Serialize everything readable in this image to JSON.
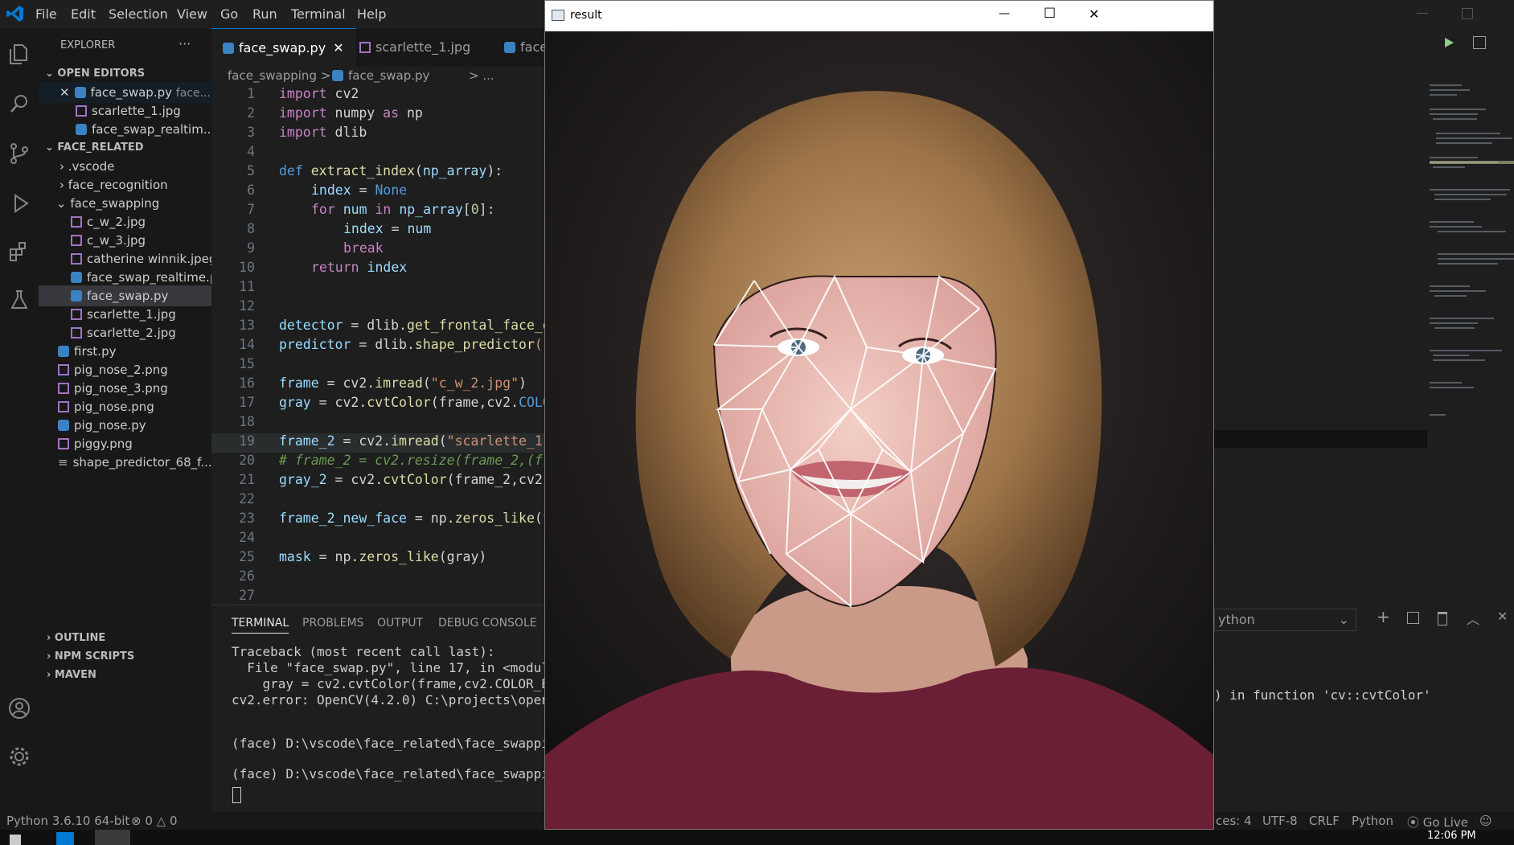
{
  "menu": [
    "File",
    "Edit",
    "Selection",
    "View",
    "Go",
    "Run",
    "Terminal",
    "Help"
  ],
  "explorer": {
    "title": "EXPLORER",
    "more": "···",
    "open_editors_label": "OPEN EDITORS",
    "open_editors": [
      "face_swap.py",
      "scarlette_1.jpg",
      "face_swap_realtim..."
    ],
    "open_editor_hint": "face...",
    "folder_label": "FACE_RELATED",
    "folders": [
      ".vscode",
      "face_recognition",
      "face_swapping"
    ],
    "face_swapping_files": [
      "c_w_2.jpg",
      "c_w_3.jpg",
      "catherine winnik.jpeg",
      "face_swap_realtime.py",
      "face_swap.py",
      "scarlette_1.jpg",
      "scarlette_2.jpg"
    ],
    "root_files": [
      "first.py",
      "pig_nose_2.png",
      "pig_nose_3.png",
      "pig_nose.png",
      "pig_nose.py",
      "piggy.png",
      "shape_predictor_68_f..."
    ],
    "bottom_sections": [
      "OUTLINE",
      "NPM SCRIPTS",
      "MAVEN"
    ]
  },
  "tabs": [
    {
      "label": "face_swap.py",
      "close": "✕"
    },
    {
      "label": "scarlette_1.jpg"
    },
    {
      "label": "face"
    }
  ],
  "breadcrumb": {
    "folder": "face_swapping",
    "sep": ">",
    "file": "face_swap.py",
    "tail": "> ..."
  },
  "code": {
    "line_numbers": [
      "1",
      "2",
      "3",
      "4",
      "5",
      "6",
      "7",
      "8",
      "9",
      "10",
      "11",
      "12",
      "13",
      "14",
      "15",
      "16",
      "17",
      "18",
      "19",
      "20",
      "21",
      "22",
      "23",
      "24",
      "25",
      "26",
      "27"
    ],
    "l1": [
      "import",
      " cv2"
    ],
    "l2": [
      "import",
      " numpy ",
      "as",
      " np"
    ],
    "l3": [
      "import",
      " dlib"
    ],
    "l5": [
      "def",
      " ",
      "extract_index",
      "(",
      "np_array",
      "):"
    ],
    "l6": [
      "index",
      " = ",
      "None"
    ],
    "l7": [
      "for",
      " ",
      "num",
      " ",
      "in",
      " ",
      "np_array",
      "[",
      "0",
      "]:"
    ],
    "l8": [
      "index",
      " = ",
      "num"
    ],
    "l9": [
      "break"
    ],
    "l10": [
      "return",
      " ",
      "index"
    ],
    "l13": [
      "detector",
      " = dlib.",
      "get_frontal_face_d"
    ],
    "l14": [
      "predictor",
      " = dlib.",
      "shape_predictor",
      "(\""
    ],
    "l16": [
      "frame",
      " = cv2.",
      "imread",
      "(",
      "\"c_w_2.jpg\"",
      ")"
    ],
    "l17": [
      "gray",
      " = cv2.",
      "cvtColor",
      "(frame,cv2.",
      "COLO"
    ],
    "l19": [
      "frame_2",
      " = cv2.",
      "imread",
      "(",
      "\"scarlette_1."
    ],
    "l20": [
      "# frame_2 = cv2.resize(frame_2,(fr"
    ],
    "l21": [
      "gray_2",
      " = cv2.",
      "cvtColor",
      "(frame_2,cv2.("
    ],
    "l23": [
      "frame_2_new_face",
      " = np.",
      "zeros_like",
      "(f"
    ],
    "l25": [
      "mask",
      " = np.",
      "zeros_like",
      "(gray)"
    ]
  },
  "panel": {
    "tabs": [
      "TERMINAL",
      "PROBLEMS",
      "OUTPUT",
      "DEBUG CONSOLE"
    ],
    "terminal_lines": [
      "Traceback (most recent call last):",
      "  File \"face_swap.py\", line 17, in <module>",
      "    gray = cv2.cvtColor(frame,cv2.COLOR_BGR",
      "cv2.error: OpenCV(4.2.0) C:\\projects\\opencv",
      "(face) D:\\vscode\\face_related\\face_swapping",
      "(face) D:\\vscode\\face_related\\face_swapping"
    ],
    "terminal_right_tail": ") in function 'cv::cvtColor'",
    "shell_dropdown": "ython"
  },
  "window": {
    "title": "result",
    "minimize": "—",
    "maximize": "☐",
    "close": "✕"
  },
  "status": {
    "python": "Python 3.6.10 64-bit",
    "errors": "0",
    "warnings": "0",
    "spaces": "ces: 4",
    "encoding": "UTF-8",
    "eol": "CRLF",
    "language": "Python",
    "golive": "Go Live"
  },
  "taskbar": {
    "time": "12:06 PM"
  },
  "colors": {
    "accent": "#0078d4",
    "keyword": "#c586c0",
    "string": "#ce9178",
    "function": "#dcdcaa"
  }
}
